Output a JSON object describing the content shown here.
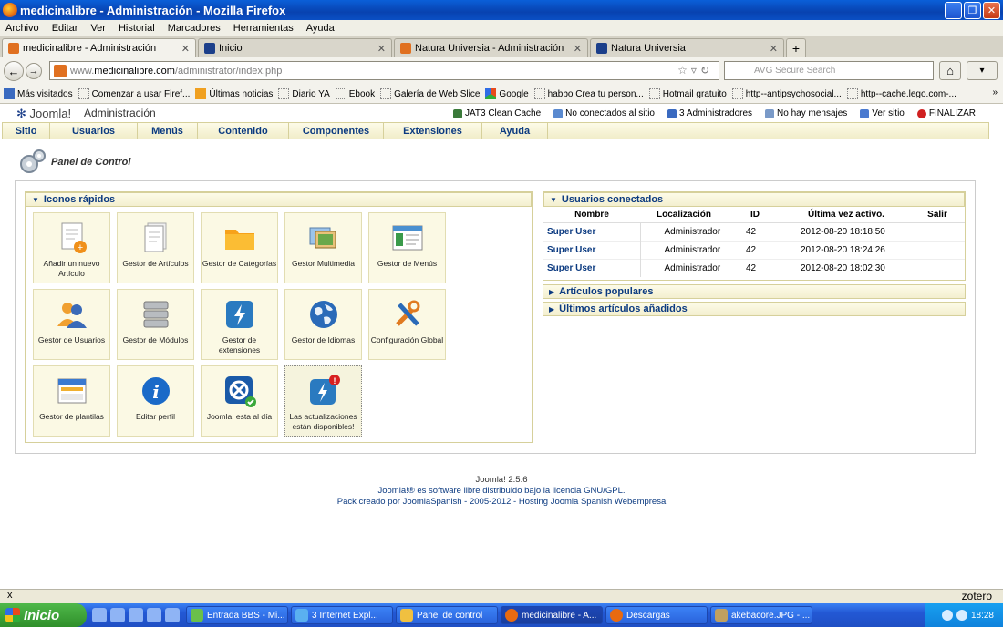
{
  "window": {
    "title": "medicinalibre - Administración - Mozilla Firefox"
  },
  "menubar": [
    "Archivo",
    "Editar",
    "Ver",
    "Historial",
    "Marcadores",
    "Herramientas",
    "Ayuda"
  ],
  "tabs": [
    {
      "label": "medicinalibre - Administración",
      "active": true
    },
    {
      "label": "Inicio"
    },
    {
      "label": "Natura Universia - Administración"
    },
    {
      "label": "Natura Universia"
    }
  ],
  "nav": {
    "url_prefix": "www.",
    "url_host": "medicinalibre.com",
    "url_path": "/administrator/index.php",
    "search_placeholder": "AVG Secure Search"
  },
  "bookmarks": [
    "Más visitados",
    "Comenzar a usar Firef...",
    "Últimas noticias",
    "Diario YA",
    "Ebook",
    "Galería de Web Slice",
    "Google",
    "habbo Crea tu person...",
    "Hotmail gratuito",
    "http--antipsychosocial...",
    "http--cache.lego.com-..."
  ],
  "joomla": {
    "logo": "Joomla!",
    "admin_label": "Administración",
    "status": [
      {
        "label": "JAT3 Clean Cache",
        "color": "#3a7a3a"
      },
      {
        "label": "No conectados al sitio",
        "color": "#5a8ad0"
      },
      {
        "label": "3 Administradores",
        "color": "#3a6ac0"
      },
      {
        "label": "No hay mensajes",
        "color": "#7a9ac8"
      },
      {
        "label": "Ver sitio",
        "color": "#4a7ad0"
      },
      {
        "label": "FINALIZAR",
        "color": "#d02020"
      }
    ],
    "menu": [
      "Sitio",
      "Usuarios",
      "Menús",
      "Contenido",
      "Componentes",
      "Extensiones",
      "Ayuda"
    ],
    "page_title": "Panel de Control",
    "quick_title": "Iconos rápidos",
    "quick_icons": [
      {
        "label": "Añadir un nuevo Artículo",
        "icon": "add-article-icon"
      },
      {
        "label": "Gestor de Artículos",
        "icon": "articles-icon"
      },
      {
        "label": "Gestor de Categorías",
        "icon": "folder-icon"
      },
      {
        "label": "Gestor Multimedia",
        "icon": "media-icon"
      },
      {
        "label": "Gestor de Menús",
        "icon": "menus-icon"
      },
      {
        "label": "Gestor de Usuarios",
        "icon": "users-icon"
      },
      {
        "label": "Gestor de Módulos",
        "icon": "modules-icon"
      },
      {
        "label": "Gestor de extensiones",
        "icon": "extensions-icon"
      },
      {
        "label": "Gestor de Idiomas",
        "icon": "globe-icon"
      },
      {
        "label": "Configuración Global",
        "icon": "tools-icon"
      },
      {
        "label": "Gestor de plantilas",
        "icon": "templates-icon"
      },
      {
        "label": "Editar perfil",
        "icon": "info-icon"
      },
      {
        "label": "Joomla! esta al día",
        "icon": "joomla-check-icon"
      },
      {
        "label": "Las actualizaciones están disponibles!",
        "icon": "update-alert-icon"
      }
    ],
    "users_panel": {
      "title": "Usuarios conectados",
      "headers": [
        "Nombre",
        "Localización",
        "ID",
        "Última vez activo.",
        "Salir"
      ],
      "rows": [
        [
          "Super User",
          "Administrador",
          "42",
          "2012-08-20 18:18:50"
        ],
        [
          "Super User",
          "Administrador",
          "42",
          "2012-08-20 18:24:26"
        ],
        [
          "Super User",
          "Administrador",
          "42",
          "2012-08-20 18:02:30"
        ]
      ]
    },
    "popular_title": "Artículos populares",
    "latest_title": "Últimos artículos añadidos",
    "footer": {
      "version": "Joomla! 2.5.6",
      "license": "Joomla!® es software libre distribuido bajo la licencia GNU/GPL.",
      "pack": "Pack creado por JoomlaSpanish - 2005-2012 - Hosting Joomla Spanish Webempresa"
    }
  },
  "statusbar": {
    "close": "x",
    "zotero": "zotero"
  },
  "taskbar": {
    "start": "Inicio",
    "tasks": [
      "Entrada BBS - Mi...",
      "3 Internet Expl...",
      "Panel de control",
      "medicinalibre - A...",
      "Descargas",
      "akebacore.JPG - ..."
    ],
    "clock": "18:28"
  }
}
